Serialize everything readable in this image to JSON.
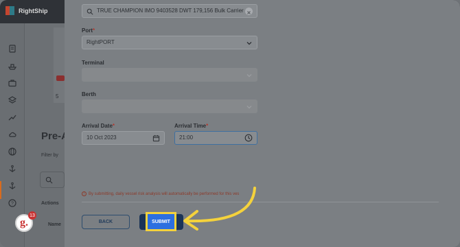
{
  "app": {
    "name": "RightShip"
  },
  "background": {
    "heading": "Pre-A",
    "filter_label": "Filter by",
    "actions_label": "Actions",
    "name_label": "Name",
    "row_number": "5",
    "notification_count": "13",
    "avatar_letter": "g."
  },
  "form": {
    "vessel": {
      "value": "TRUE CHAMPION  IMO 9403528  DWT 179,156  Bulk Carrier"
    },
    "port": {
      "label": "Port",
      "required_mark": "*",
      "value": "RightPORT"
    },
    "terminal": {
      "label": "Terminal",
      "value": ""
    },
    "berth": {
      "label": "Berth",
      "value": ""
    },
    "arrival_date": {
      "label": "Arrival Date",
      "required_mark": "*",
      "value": "10 Oct 2023"
    },
    "arrival_time": {
      "label": "Arrival Time",
      "required_mark": "*",
      "value": "21:00"
    },
    "notice": "By submitting, daily vessel risk analysis will automatically be performed for this ves",
    "back_label": "BACK",
    "submit_label": "SUBMIT"
  },
  "colors": {
    "highlight": "#f4d23c",
    "submit_bg": "#2c6fe0",
    "accent_orange": "#d86b1e"
  }
}
